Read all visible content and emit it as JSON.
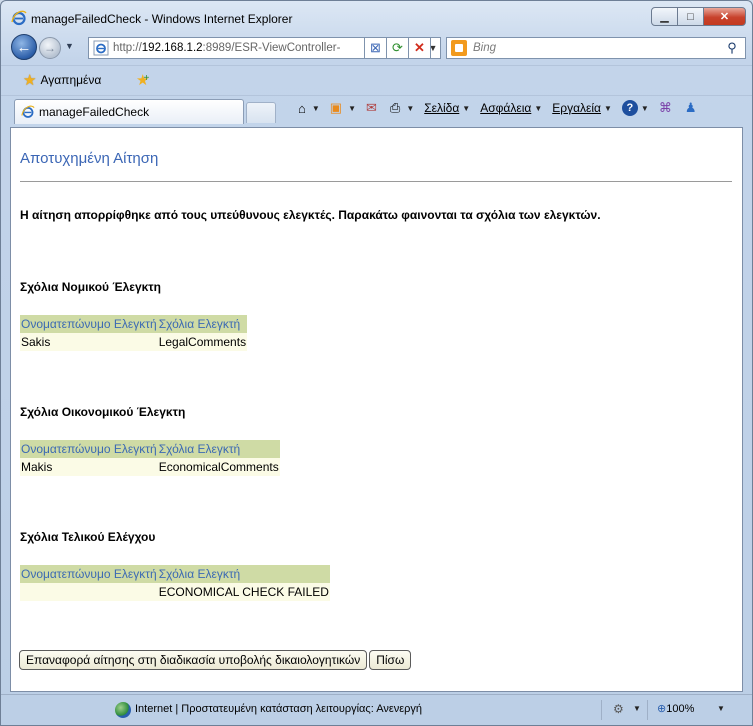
{
  "window": {
    "title": "manageFailedCheck - Windows Internet Explorer",
    "buttons": {
      "minimize": "▁",
      "maximize": "□",
      "close": "✕"
    }
  },
  "address_bar": {
    "prefix": "http://",
    "host": "192.168.1.2",
    "rest": ":8989/ESR-ViewController-",
    "dropdown": "▼"
  },
  "search": {
    "placeholder": "Bing",
    "go_icon": "⚲"
  },
  "favorites": {
    "label": "Αγαπημένα"
  },
  "tab": {
    "label": "manageFailedCheck"
  },
  "command_bar": {
    "page": "Σελίδα",
    "safety": "Ασφάλεια",
    "tools": "Εργαλεία",
    "help": "?"
  },
  "page": {
    "title": "Αποτυχημένη Αίτηση",
    "message": "Η αίτηση απορρίφθηκε από τους υπεύθυνους ελεγκτές. Παρακάτω φαινονται τα σχόλια των ελεγκτών.",
    "sections": [
      {
        "heading": "Σχόλια Νομικού Έλεγκτη",
        "columns": [
          "Ονοματεπώνυμο Ελεγκτή",
          "Σχόλια Ελεγκτή"
        ],
        "row": [
          "Sakis",
          "LegalComments"
        ]
      },
      {
        "heading": "Σχόλια Οικονομικού Έλεγκτη",
        "columns": [
          "Ονοματεπώνυμο Ελεγκτή",
          "Σχόλια Ελεγκτή"
        ],
        "row": [
          "Makis",
          "EconomicalComments"
        ]
      },
      {
        "heading": "Σχόλια Τελικού Ελέγχου",
        "columns": [
          "Ονοματεπώνυμο Ελεγκτή",
          "Σχόλια Ελεγκτή"
        ],
        "row": [
          "",
          "ECONOMICAL CHECK FAILED"
        ]
      }
    ],
    "buttons": {
      "restore": "Επαναφορά αίτησης στη διαδικασία υποβολής δικαιολογητικών",
      "back": "Πίσω"
    }
  },
  "status_bar": {
    "zone_text": "Internet | Προστατευμένη κατάσταση λειτουργίας: Ανενεργή",
    "zoom": "100%"
  },
  "colors": {
    "title_blue": "#3b66b5",
    "header_bg": "#cfdba5",
    "cell_bg": "#fbfbe6"
  }
}
